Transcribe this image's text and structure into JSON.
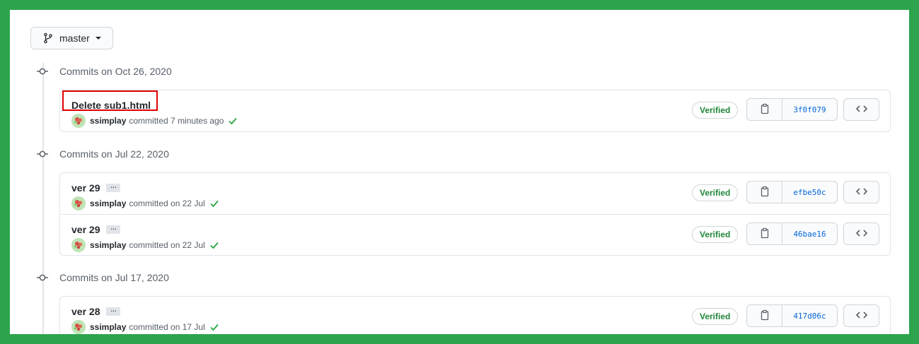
{
  "branch": {
    "label": "master"
  },
  "groups": [
    {
      "title": "Commits on Oct 26, 2020",
      "commits": [
        {
          "message": "Delete sub1.html",
          "has_ellipsis": false,
          "author": "ssimplay",
          "when": "committed 7 minutes ago",
          "verified": "Verified",
          "sha": "3f0f079"
        }
      ]
    },
    {
      "title": "Commits on Jul 22, 2020",
      "commits": [
        {
          "message": "ver 29",
          "has_ellipsis": true,
          "ellipsis": "…",
          "author": "ssimplay",
          "when": "committed on 22 Jul",
          "verified": "Verified",
          "sha": "efbe50c"
        },
        {
          "message": "ver 29",
          "has_ellipsis": true,
          "ellipsis": "…",
          "author": "ssimplay",
          "when": "committed on 22 Jul",
          "verified": "Verified",
          "sha": "46bae16"
        }
      ]
    },
    {
      "title": "Commits on Jul 17, 2020",
      "commits": [
        {
          "message": "ver 28",
          "has_ellipsis": true,
          "ellipsis": "…",
          "author": "ssimplay",
          "when": "committed on 17 Jul",
          "verified": "Verified",
          "sha": "417d06c"
        }
      ]
    }
  ],
  "colors": {
    "frame": "#2ea44f",
    "verified_text": "#22863a",
    "sha_link": "#0366d6",
    "highlight": "#e00000"
  },
  "icons": {
    "branch": "git-branch-icon",
    "node": "git-commit-icon",
    "copy": "clipboard-icon",
    "browse": "code-icon",
    "check": "check-icon"
  }
}
